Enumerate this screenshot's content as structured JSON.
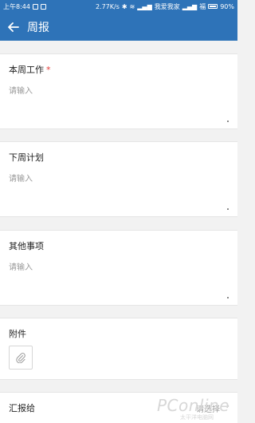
{
  "status_bar": {
    "time": "上午8:44",
    "net_speed": "2.77K/s",
    "carrier1": "我爱我家",
    "carrier2": "福",
    "battery": "90%"
  },
  "header": {
    "title": "周报"
  },
  "sections": {
    "this_week": {
      "label": "本周工作",
      "required_mark": "*",
      "placeholder": "请输入"
    },
    "next_week": {
      "label": "下周计划",
      "placeholder": "请输入"
    },
    "other": {
      "label": "其他事项",
      "placeholder": "请输入"
    },
    "attachment": {
      "label": "附件"
    },
    "report_to": {
      "label": "汇报给",
      "value": "请选择"
    }
  },
  "watermark": {
    "brand": "PConline",
    "sub": "太平洋电脑网"
  },
  "colors": {
    "primary": "#2e73b8",
    "required": "#e53935"
  }
}
